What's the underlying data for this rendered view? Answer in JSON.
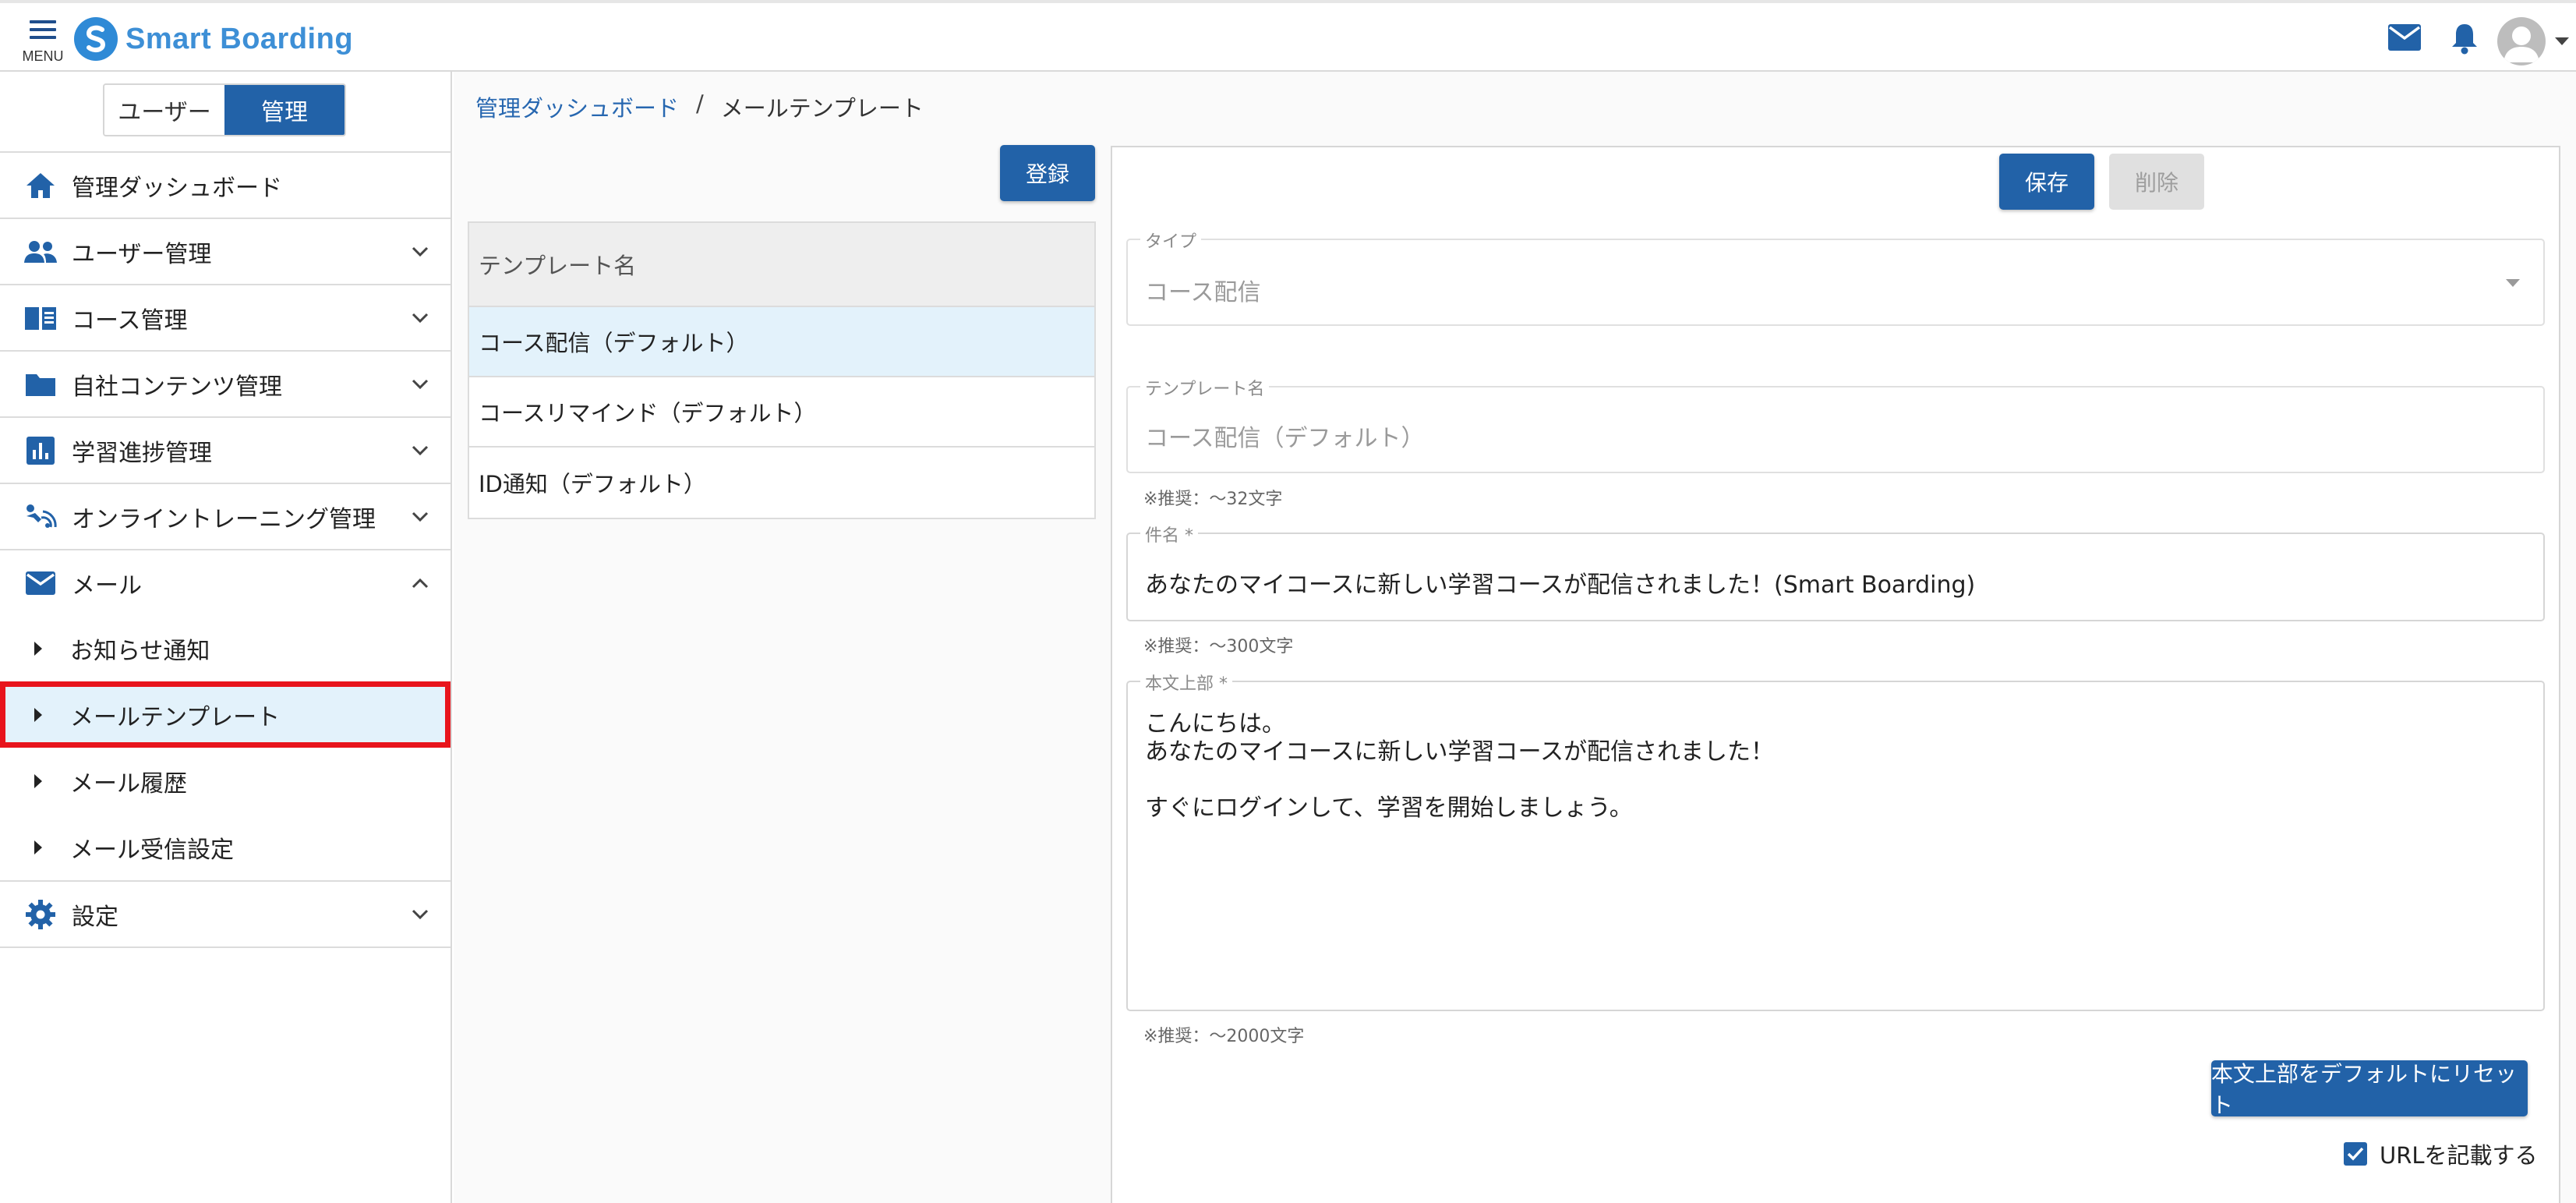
{
  "header": {
    "menu_label": "MENU",
    "logo_text": "Smart Boarding"
  },
  "sidebar": {
    "mode_toggle": {
      "user": "ユーザー",
      "admin": "管理"
    },
    "items": [
      {
        "label": "管理ダッシュボード"
      },
      {
        "label": "ユーザー管理"
      },
      {
        "label": "コース管理"
      },
      {
        "label": "自社コンテンツ管理"
      },
      {
        "label": "学習進捗管理"
      },
      {
        "label": "オンライントレーニング管理"
      },
      {
        "label": "メール"
      },
      {
        "label": "設定"
      }
    ],
    "mail_sub": [
      {
        "label": "お知らせ通知"
      },
      {
        "label": "メールテンプレート"
      },
      {
        "label": "メール履歴"
      },
      {
        "label": "メール受信設定"
      }
    ]
  },
  "breadcrumb": {
    "parent": "管理ダッシュボード",
    "separator": "/",
    "current": "メールテンプレート"
  },
  "list": {
    "register_label": "登録",
    "header": "テンプレート名",
    "rows": [
      {
        "name": "コース配信（デフォルト）"
      },
      {
        "name": "コースリマインド（デフォルト）"
      },
      {
        "name": "ID通知（デフォルト）"
      }
    ]
  },
  "editor": {
    "save_label": "保存",
    "delete_label": "削除",
    "type": {
      "label": "タイプ",
      "value": "コース配信"
    },
    "template_name": {
      "label": "テンプレート名",
      "value": "コース配信（デフォルト）",
      "hint": "※推奨：～32文字"
    },
    "subject": {
      "label": "件名 *",
      "value": "あなたのマイコースに新しい学習コースが配信されました！(Smart Boarding)",
      "hint": "※推奨：～300文字"
    },
    "body_top": {
      "label": "本文上部 *",
      "value": "こんにちは。\nあなたのマイコースに新しい学習コースが配信されました！\n\nすぐにログインして、学習を開始しましょう。",
      "hint": "※推奨：～2000文字"
    },
    "reset_label": "本文上部をデフォルトにリセット",
    "url_checkbox_label": "URLを記載する",
    "url_checked": true
  },
  "colors": {
    "primary": "#2262a8",
    "link": "#2767b0",
    "selected_bg": "#e3f2fb",
    "highlight_outline": "#e8141c"
  }
}
